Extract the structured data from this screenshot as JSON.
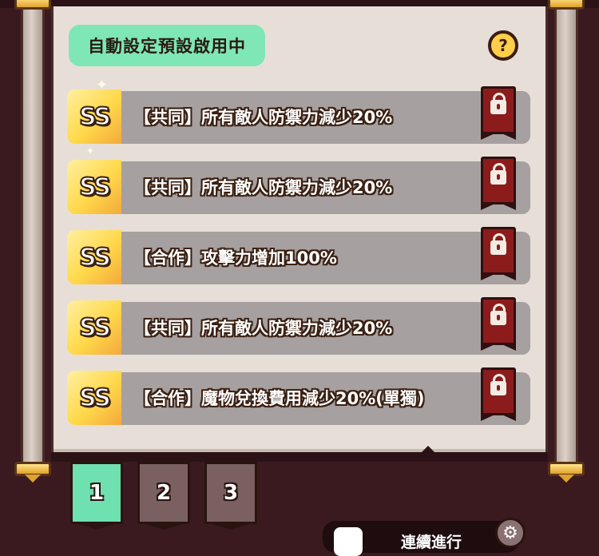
{
  "header": {
    "preset_status": "自動設定預設啟用中",
    "help_icon": "question-icon"
  },
  "options": [
    {
      "grade": "SS",
      "text": "【共同】所有敵人防禦力減少20%",
      "locked": true
    },
    {
      "grade": "SS",
      "text": "【共同】所有敵人防禦力減少20%",
      "locked": true
    },
    {
      "grade": "SS",
      "text": "【合作】攻擊力增加100%",
      "locked": true
    },
    {
      "grade": "SS",
      "text": "【共同】所有敵人防禦力減少20%",
      "locked": true
    },
    {
      "grade": "SS",
      "text": "【合作】魔物兌換費用減少20%(單獨)",
      "locked": true
    }
  ],
  "tabs": [
    {
      "label": "1",
      "active": true
    },
    {
      "label": "2",
      "active": false
    },
    {
      "label": "3",
      "active": false
    }
  ],
  "footer": {
    "continuous_label": "連續進行",
    "settings_icon": "gear-icon"
  },
  "colors": {
    "accent_green": "#7fe6b5",
    "lock_red": "#8c1c1c",
    "grade_gold": "#ffd84a"
  }
}
